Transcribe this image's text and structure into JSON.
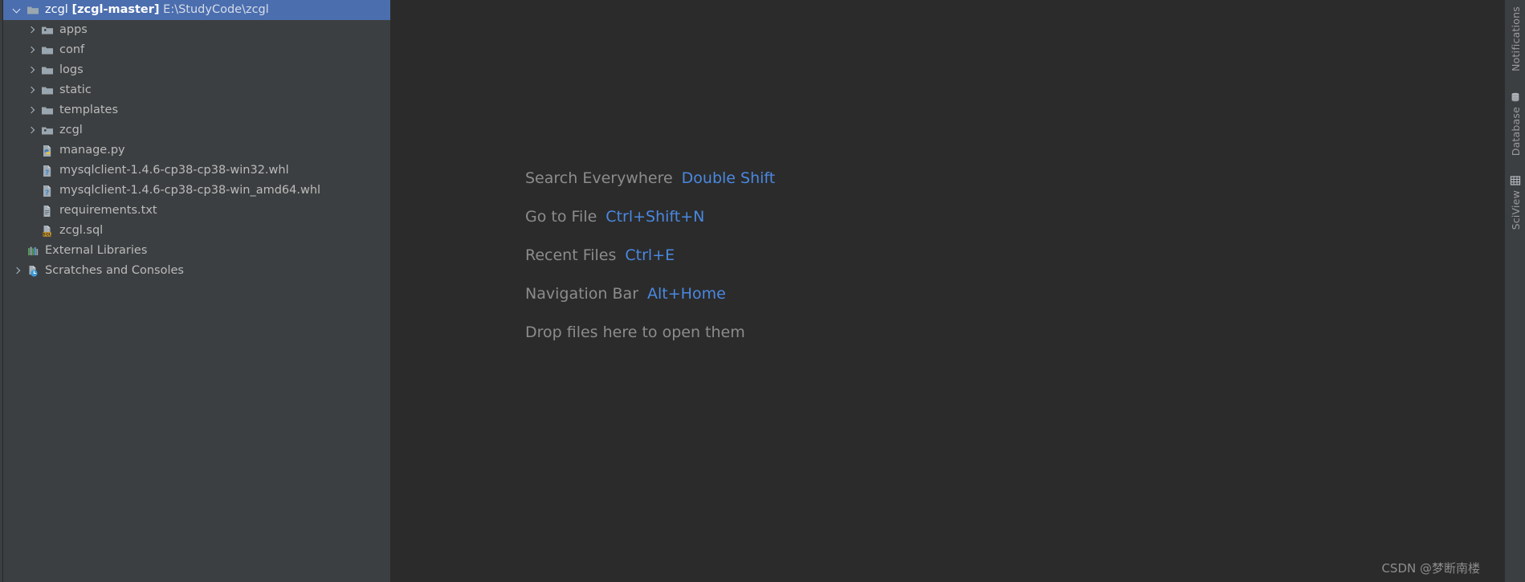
{
  "window": {
    "background": "#2b2b2b",
    "panel_background": "#3c3f41",
    "selection_color": "#4b6eaf",
    "accent_link": "#4a88e0"
  },
  "project_tree": {
    "root": {
      "name": "zcgl",
      "branch": "[zcgl-master]",
      "path": "E:\\StudyCode\\zcgl",
      "icon": "folder-icon",
      "expanded": true,
      "selected": true
    },
    "items": [
      {
        "label": "apps",
        "icon": "package-folder-icon",
        "expandable": true,
        "indent": 1
      },
      {
        "label": "conf",
        "icon": "folder-icon",
        "expandable": true,
        "indent": 1
      },
      {
        "label": "logs",
        "icon": "folder-icon",
        "expandable": true,
        "indent": 1
      },
      {
        "label": "static",
        "icon": "folder-icon",
        "expandable": true,
        "indent": 1
      },
      {
        "label": "templates",
        "icon": "folder-icon",
        "expandable": true,
        "indent": 1
      },
      {
        "label": "zcgl",
        "icon": "package-folder-icon",
        "expandable": true,
        "indent": 1
      },
      {
        "label": "manage.py",
        "icon": "python-file-icon",
        "expandable": false,
        "indent": 1
      },
      {
        "label": "mysqlclient-1.4.6-cp38-cp38-win32.whl",
        "icon": "unknown-file-icon",
        "expandable": false,
        "indent": 1
      },
      {
        "label": "mysqlclient-1.4.6-cp38-cp38-win_amd64.whl",
        "icon": "unknown-file-icon",
        "expandable": false,
        "indent": 1
      },
      {
        "label": "requirements.txt",
        "icon": "text-file-icon",
        "expandable": false,
        "indent": 1
      },
      {
        "label": "zcgl.sql",
        "icon": "sql-file-icon",
        "expandable": false,
        "indent": 1
      },
      {
        "label": "External Libraries",
        "icon": "libraries-icon",
        "expandable": false,
        "indent": 0
      },
      {
        "label": "Scratches and Consoles",
        "icon": "scratches-icon",
        "expandable": true,
        "indent": 0
      }
    ]
  },
  "editor": {
    "shortcuts": [
      {
        "action": "Search Everywhere",
        "key": "Double Shift"
      },
      {
        "action": "Go to File",
        "key": "Ctrl+Shift+N"
      },
      {
        "action": "Recent Files",
        "key": "Ctrl+E"
      },
      {
        "action": "Navigation Bar",
        "key": "Alt+Home"
      }
    ],
    "drop_hint": "Drop files here to open them"
  },
  "right_toolbar": {
    "buttons": [
      {
        "label": "Notifications",
        "icon": "bell-icon"
      },
      {
        "label": "Database",
        "icon": "database-icon"
      },
      {
        "label": "SciView",
        "icon": "grid-icon"
      }
    ]
  },
  "watermark": {
    "text": "CSDN @梦断南楼"
  }
}
